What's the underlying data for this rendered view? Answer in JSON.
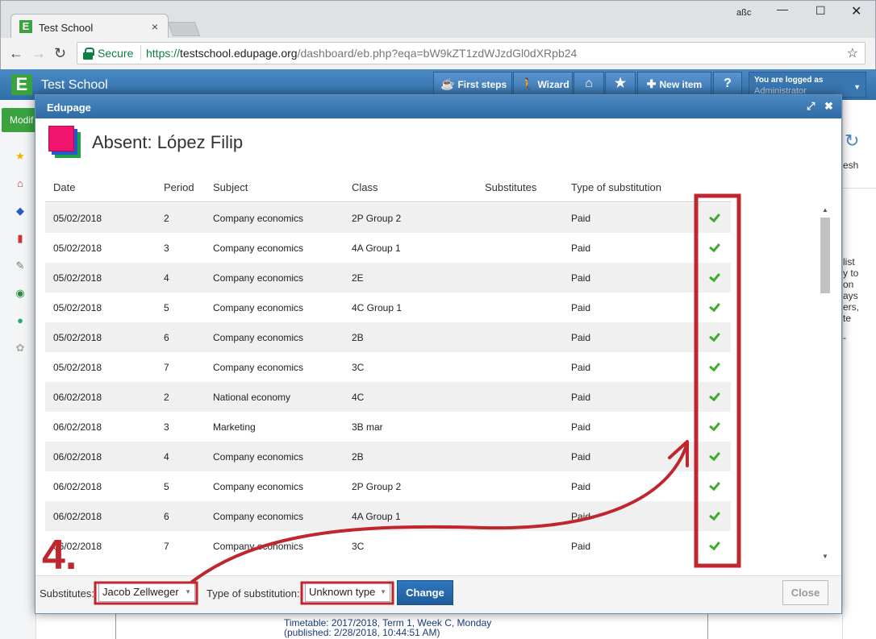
{
  "browser": {
    "tab_title": "Test School",
    "tab_close": "×",
    "secure_label": "Secure",
    "url_scheme": "https://",
    "url_host": "testschool.edupage.org",
    "url_path": "/dashboard/eb.php?eqa=bW9kZT1zdWJzdGl0dXRpb24",
    "corner_text": "aßc"
  },
  "app": {
    "logo_letter": "E",
    "name": "Test School",
    "toolbar": {
      "first_steps": "First steps",
      "wizard": "Wizard",
      "new_item": "New item",
      "help": "?"
    },
    "logged_in_label": "You are logged as",
    "logged_in_user": "Administrator"
  },
  "background": {
    "modify_btn": "Modif",
    "refresh_label": "esh",
    "side_text": [
      "list",
      "y to",
      "on",
      "ays",
      "ers,",
      "te",
      "-"
    ],
    "timetable_line1": "Timetable: 2017/2018, Term 1, Week C, Monday",
    "timetable_line2": "(published: 2/28/2018, 10:44:51 AM)"
  },
  "dialog": {
    "title": "Edupage",
    "absent_title": "Absent: López Filip",
    "columns": [
      "Date",
      "Period",
      "Subject",
      "Class",
      "Substitutes",
      "Type of substitution"
    ],
    "rows": [
      {
        "date": "05/02/2018",
        "period": "2",
        "subject": "Company economics",
        "class": "2P Group 2",
        "substitutes": "",
        "type": "Paid"
      },
      {
        "date": "05/02/2018",
        "period": "3",
        "subject": "Company economics",
        "class": "4A Group 1",
        "substitutes": "",
        "type": "Paid"
      },
      {
        "date": "05/02/2018",
        "period": "4",
        "subject": "Company economics",
        "class": "2E",
        "substitutes": "",
        "type": "Paid"
      },
      {
        "date": "05/02/2018",
        "period": "5",
        "subject": "Company economics",
        "class": "4C Group 1",
        "substitutes": "",
        "type": "Paid"
      },
      {
        "date": "05/02/2018",
        "period": "6",
        "subject": "Company economics",
        "class": "2B",
        "substitutes": "",
        "type": "Paid"
      },
      {
        "date": "05/02/2018",
        "period": "7",
        "subject": "Company economics",
        "class": "3C",
        "substitutes": "",
        "type": "Paid"
      },
      {
        "date": "06/02/2018",
        "period": "2",
        "subject": "National economy",
        "class": "4C",
        "substitutes": "",
        "type": "Paid"
      },
      {
        "date": "06/02/2018",
        "period": "3",
        "subject": "Marketing",
        "class": "3B mar",
        "substitutes": "",
        "type": "Paid"
      },
      {
        "date": "06/02/2018",
        "period": "4",
        "subject": "Company economics",
        "class": "2B",
        "substitutes": "",
        "type": "Paid"
      },
      {
        "date": "06/02/2018",
        "period": "5",
        "subject": "Company economics",
        "class": "2P Group 2",
        "substitutes": "",
        "type": "Paid"
      },
      {
        "date": "06/02/2018",
        "period": "6",
        "subject": "Company economics",
        "class": "4A Group 1",
        "substitutes": "",
        "type": "Paid"
      },
      {
        "date": "06/02/2018",
        "period": "7",
        "subject": "Company economics",
        "class": "3C",
        "substitutes": "",
        "type": "Paid"
      }
    ],
    "footer": {
      "substitutes_label": "Substitutes:",
      "substitutes_value": "Jacob Zellweger",
      "type_label": "Type of substitution:",
      "type_value": "Unknown type",
      "change_btn": "Change",
      "close_btn": "Close"
    }
  },
  "annotation": {
    "step_label": "4.",
    "color": "#c0262d"
  }
}
